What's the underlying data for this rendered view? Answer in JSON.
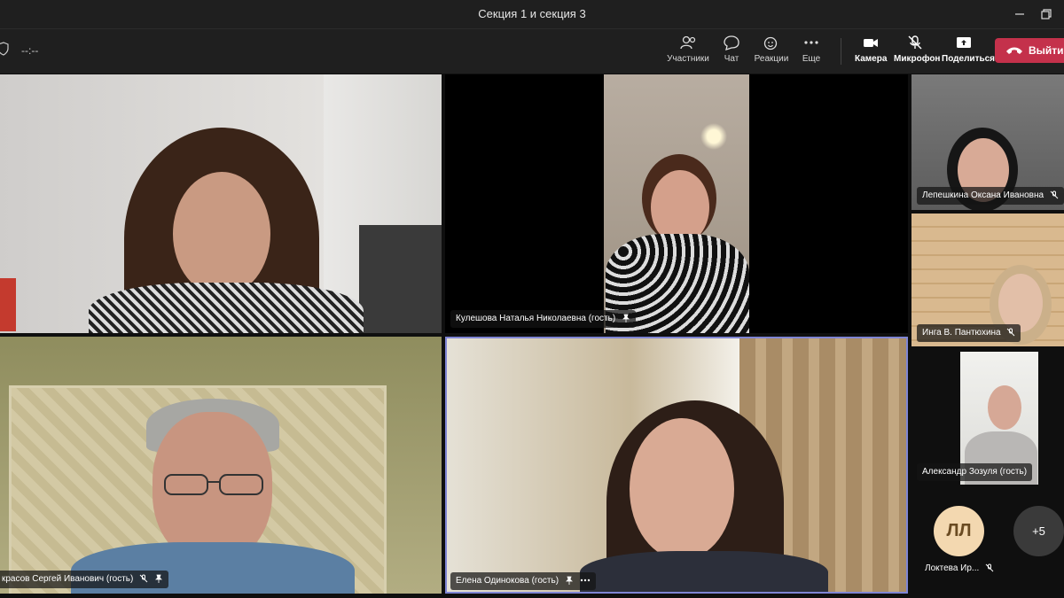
{
  "window": {
    "title": "Секция 1 и секция 3"
  },
  "toolbar": {
    "timer": "--:--",
    "participants_label": "Участники",
    "chat_label": "Чат",
    "reactions_label": "Реакции",
    "more_label": "Еще",
    "camera_label": "Камера",
    "mic_label": "Микрофон",
    "share_label": "Поделиться",
    "leave_label": "Выйти",
    "leave_color": "#c4314b"
  },
  "participants": {
    "p2": {
      "name": "Кулешова Наталья Николаевна (гость)"
    },
    "p3": {
      "name": "Лепешкина Оксана Ивановна"
    },
    "p4": {
      "name": "Инга В. Пантюхина"
    },
    "p5": {
      "name": "Александр Зозуля (гость)"
    },
    "p6": {
      "name": "кра​сов Сергей Иванович (гость)"
    },
    "p7": {
      "name": "Елена Одинокова (гость)"
    },
    "p8": {
      "name": "Локтева Ир...",
      "initials": "ЛЛ"
    },
    "overflow": "+5"
  }
}
